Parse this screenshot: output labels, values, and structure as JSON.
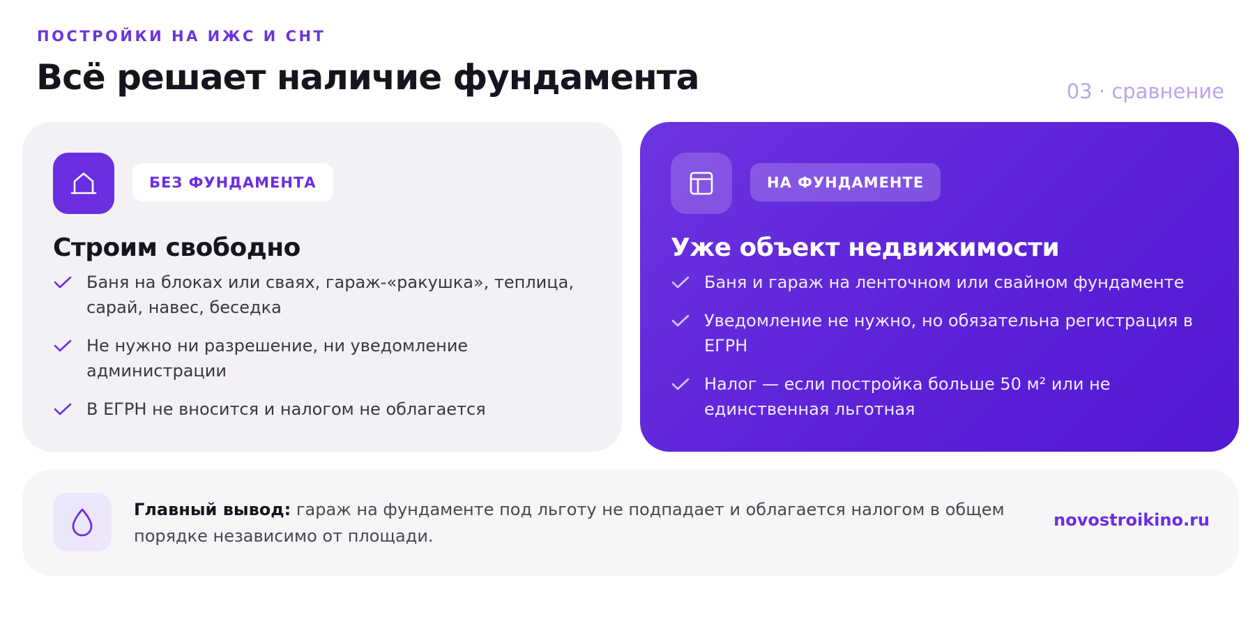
{
  "header": {
    "eyebrow": "ПОСТРОЙКИ НА ИЖС И СНТ",
    "title": "Всё решает наличие фундамента",
    "page_marker": "03 · сравнение"
  },
  "cards": [
    {
      "icon": "house-icon",
      "tag": "БЕЗ ФУНДАМЕНТА",
      "heading": "Строим свободно",
      "bullets": [
        "Баня на блоках или сваях, гараж-«ракушка», теплица, сарай, навес, беседка",
        "Не нужно ни разрешение, ни уведомление администрации",
        "В ЕГРН не вносится и налогом не облагается"
      ]
    },
    {
      "icon": "layout-icon",
      "tag": "НА ФУНДАМЕНТЕ",
      "heading": "Уже объект недвижимости",
      "bullets": [
        "Баня и гараж на ленточном или свайном фундаменте",
        "Уведомление не нужно, но обязательна регистрация в ЕГРН",
        "Налог — если постройка больше 50 м² или не единственная льготная"
      ]
    }
  ],
  "summary": {
    "icon": "droplet-icon",
    "label": "Главный вывод:",
    "text": " гараж на фундаменте под льготу не подпадает и облагается налогом в общем порядке независимо от площади.",
    "site": "novostroikino.ru"
  },
  "colors": {
    "accent": "#6a2ee0",
    "card_light_bg": "#f3f1f5",
    "card_dark_bg": "#5b22d8"
  }
}
